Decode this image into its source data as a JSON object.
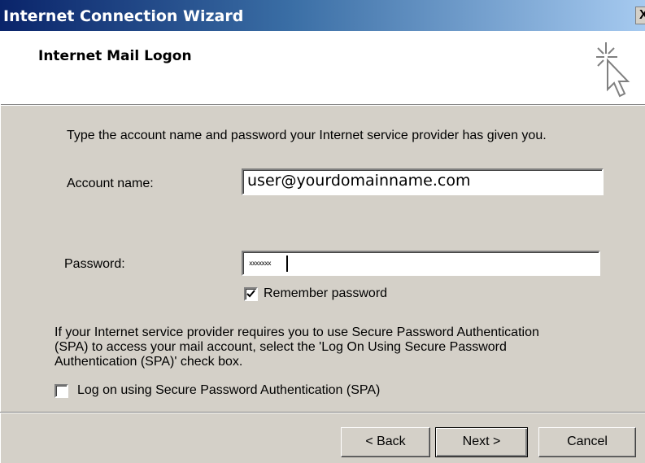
{
  "window": {
    "title": "Internet Connection Wizard",
    "close_label": "X"
  },
  "header": {
    "title": "Internet Mail Logon",
    "icon": "wizard-cursor-sparkle-icon"
  },
  "form": {
    "intro": "Type the account name and password your Internet service provider has given you.",
    "account_label": "Account name:",
    "account_value": "user@yourdomainname.com",
    "password_label": "Password:",
    "password_mask": "xxxxxxx",
    "remember_label": "Remember password",
    "remember_checked": true,
    "spa_info": [
      "If your Internet service provider requires you to use Secure Password Authentication",
      "(SPA) to access your mail account, select the 'Log On Using Secure Password",
      "Authentication (SPA)' check box."
    ],
    "spa_label": "Log on using Secure Password Authentication (SPA)",
    "spa_checked": false
  },
  "buttons": {
    "back": "< Back",
    "next": "Next >",
    "cancel": "Cancel"
  },
  "colors": {
    "dialog_face": "#d4d0c8",
    "title_gradient_start": "#0a246a",
    "title_gradient_end": "#a6caf0"
  }
}
